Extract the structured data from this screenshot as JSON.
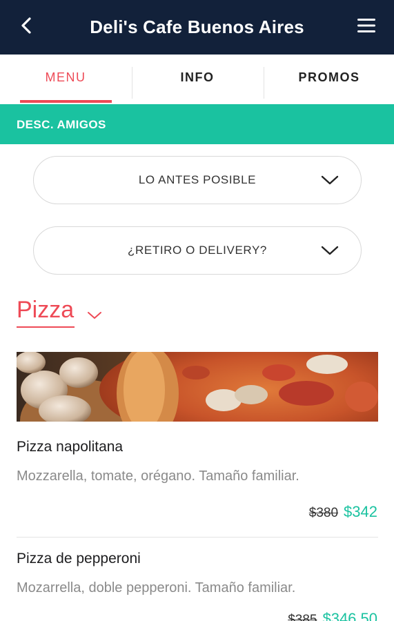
{
  "header": {
    "title": "Deli's Cafe Buenos Aires",
    "back_icon": "chevron-left-icon",
    "menu_icon": "hamburger-menu-icon"
  },
  "tabs": [
    {
      "label": "MENU",
      "active": true
    },
    {
      "label": "INFO",
      "active": false
    },
    {
      "label": "PROMOS",
      "active": false
    }
  ],
  "promo_bar": {
    "label": "DESC. AMIGOS"
  },
  "selectors": {
    "time": {
      "label": "LO ANTES POSIBLE",
      "icon": "chevron-down-icon"
    },
    "mode": {
      "label": "¿RETIRO O DELIVERY?",
      "icon": "chevron-down-icon"
    }
  },
  "category": {
    "title": "Pizza",
    "icon": "chevron-down-icon"
  },
  "items": [
    {
      "name": "Pizza napolitana",
      "description": "Mozzarella, tomate, orégano. Tamaño familiar.",
      "old_price": "$380",
      "new_price": "$342"
    },
    {
      "name": "Pizza de pepperoni",
      "description": "Mozarrella, doble pepperoni. Tamaño familiar.",
      "old_price": "$385",
      "new_price": "$346.50"
    }
  ],
  "colors": {
    "header_bg": "#12213a",
    "accent_red": "#ee4a56",
    "accent_teal": "#1ac2a0"
  }
}
